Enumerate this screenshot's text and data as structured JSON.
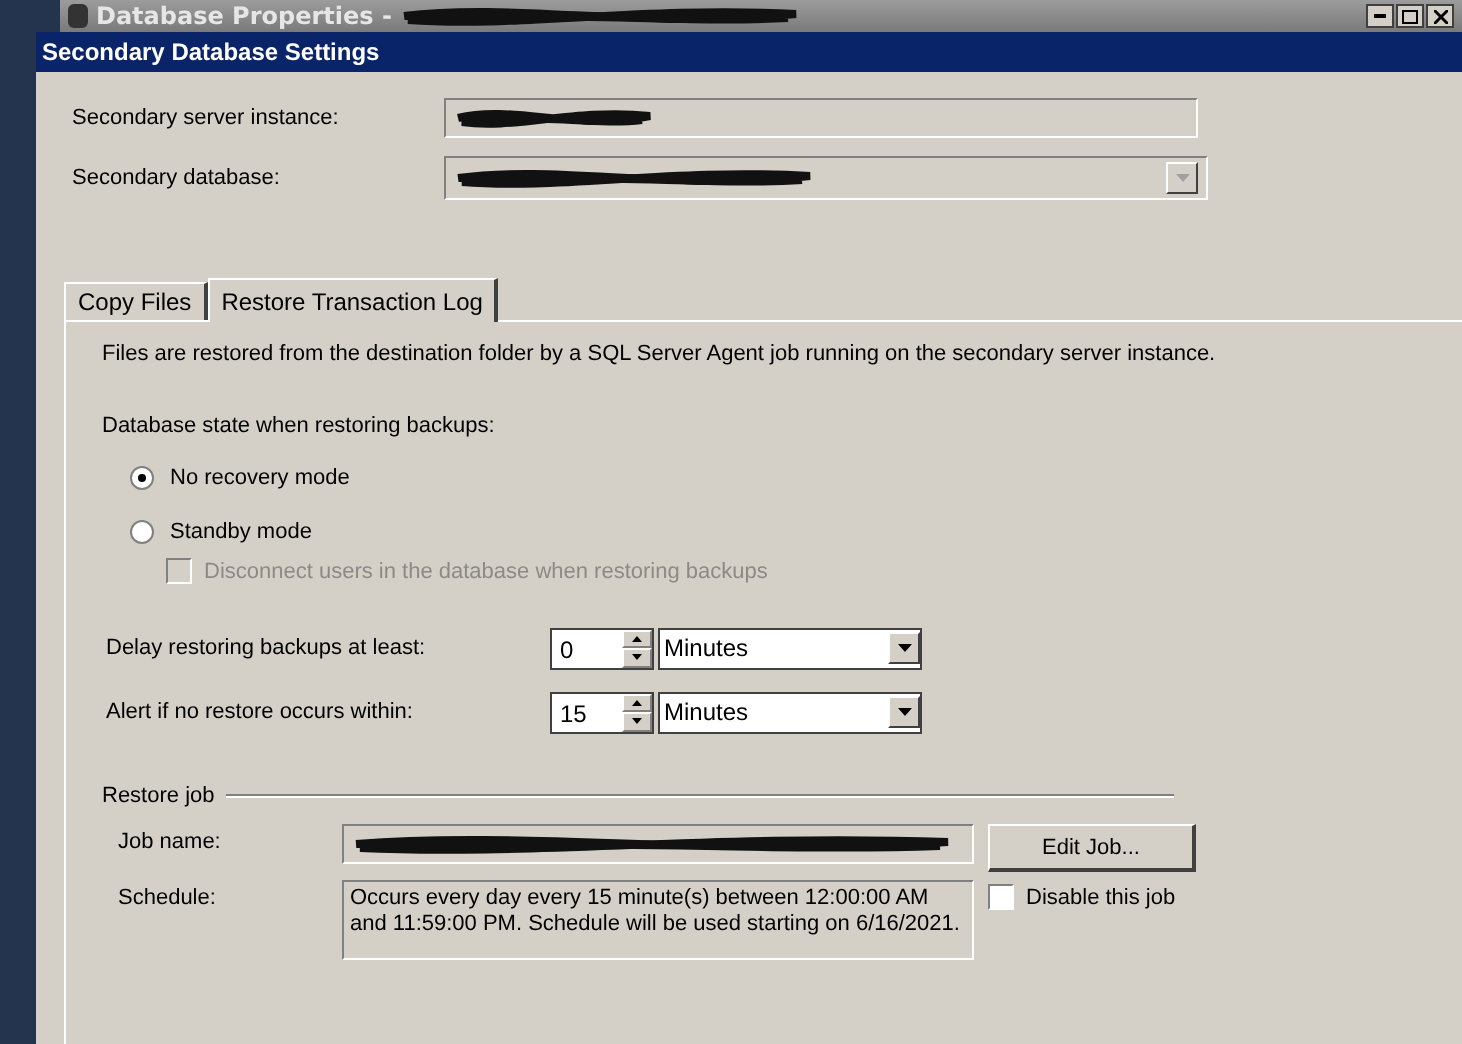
{
  "background_window": {
    "title": "Database Properties -"
  },
  "dialog": {
    "title": "Secondary Database Settings"
  },
  "fields": [
    {
      "label": "Secondary server instance:",
      "kind": "text"
    },
    {
      "label": "Secondary database:",
      "kind": "combo"
    }
  ],
  "tabs": [
    {
      "label": "Copy Files",
      "selected": false
    },
    {
      "label": "Restore Transaction Log",
      "selected": true
    }
  ],
  "description": "Files are restored from the destination folder by a SQL Server Agent job running on the secondary server instance.",
  "state_label": "Database state when restoring backups:",
  "modes": [
    {
      "label": "No recovery mode",
      "selected": true
    },
    {
      "label": "Standby mode",
      "selected": false
    }
  ],
  "disconnect": {
    "label": "Disconnect users in the database when restoring backups",
    "checked": false,
    "disabled": true
  },
  "timings": [
    {
      "label": "Delay restoring backups at least:",
      "value": "0",
      "unit": "Minutes"
    },
    {
      "label": "Alert if no restore occurs within:",
      "value": "15",
      "unit": "Minutes"
    }
  ],
  "restore_job": {
    "heading": "Restore job",
    "job_name_label": "Job name:",
    "edit_button": "Edit Job...",
    "schedule_label": "Schedule:",
    "schedule": "Occurs every day every 15 minute(s) between 12:00:00 AM and 11:59:00 PM. Schedule will be used starting on 6/16/2021.",
    "disable": {
      "label": "Disable this job",
      "checked": false
    }
  }
}
